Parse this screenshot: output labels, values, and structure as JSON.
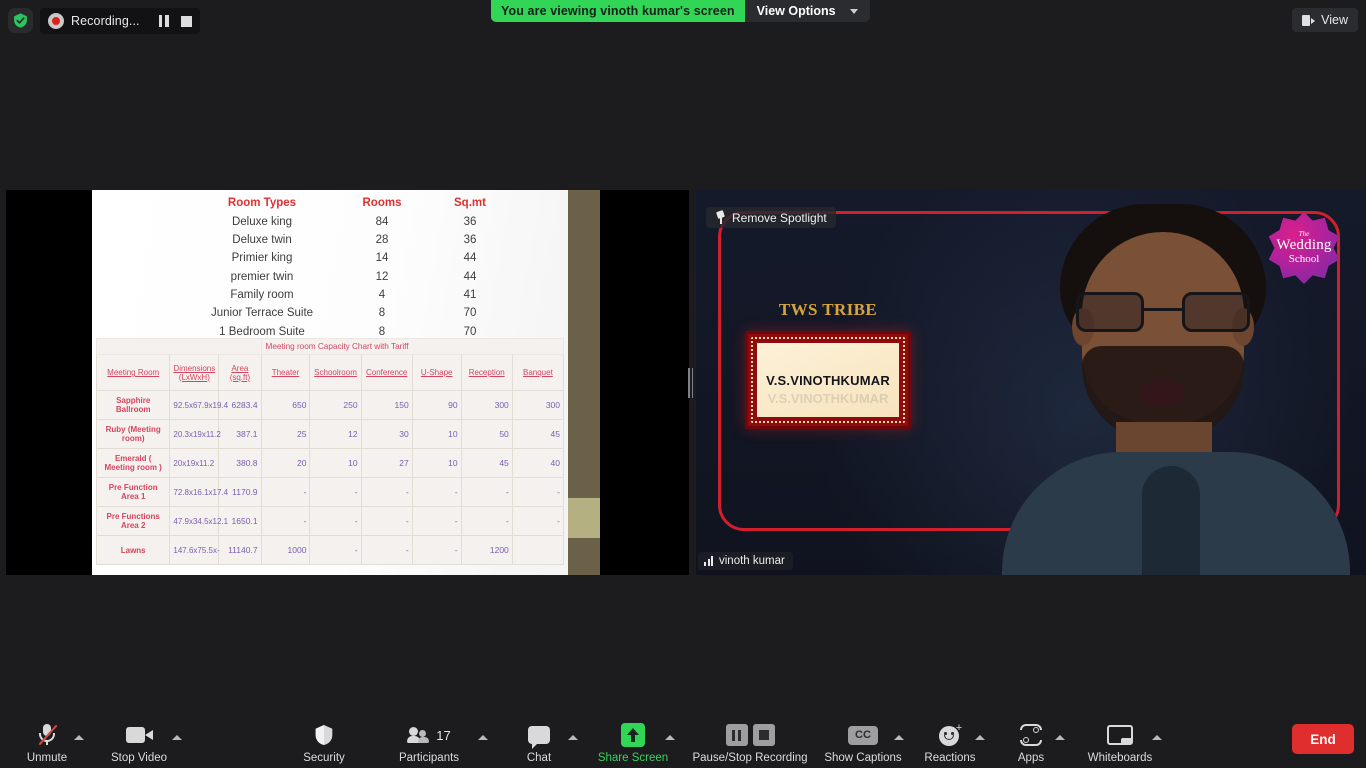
{
  "topbar": {
    "shield_icon": "shield-check-icon",
    "recording_label": "Recording...",
    "pause_icon": "pause-icon",
    "stop_icon": "stop-icon",
    "share_banner_text": "You are viewing vinoth kumar's screen",
    "view_options_label": "View Options",
    "view_options_caret": "chevron-down-icon",
    "view_button_label": "View",
    "view_button_icon": "layout-view-icon"
  },
  "shared_screen": {
    "room_table": {
      "headers": [
        "Room Types",
        "Rooms",
        "Sq.mt"
      ],
      "rows": [
        [
          "Deluxe king",
          "84",
          "36"
        ],
        [
          "Deluxe twin",
          "28",
          "36"
        ],
        [
          "Primier king",
          "14",
          "44"
        ],
        [
          "premier twin",
          "12",
          "44"
        ],
        [
          "Family room",
          "4",
          "41"
        ],
        [
          "Junior Terrace Suite",
          "8",
          "70"
        ],
        [
          "1 Bedroom Suite",
          "8",
          "70"
        ]
      ]
    },
    "capacity_table": {
      "title": "Meeting room Capacity Chart with Tariff",
      "headers": [
        "Meeting Room",
        "Dimensions (LxWxH)",
        "Area (sq.ft)",
        "Theater",
        "Schoolroom",
        "Conference",
        "U-Shape",
        "Reception",
        "Banquet"
      ],
      "rows": [
        [
          "Sapphire Ballroom",
          "92.5x67.9x19.4",
          "6283.4",
          "650",
          "250",
          "150",
          "90",
          "300",
          "300"
        ],
        [
          "Ruby (Meeting room)",
          "20.3x19x11.2",
          "387.1",
          "25",
          "12",
          "30",
          "10",
          "50",
          "45"
        ],
        [
          "Emerald ( Meeting room )",
          "20x19x11.2",
          "380.8",
          "20",
          "10",
          "27",
          "10",
          "45",
          "40"
        ],
        [
          "Pre Function Area 1",
          "72.8x16.1x17.4",
          "1170.9",
          "-",
          "-",
          "-",
          "-",
          "-",
          "-"
        ],
        [
          "Pre Functions Area 2",
          "47.9x34.5x12.1",
          "1650.1",
          "-",
          "-",
          "-",
          "-",
          "-",
          "-"
        ],
        [
          "Lawns",
          "147.6x75.5x-",
          "11140.7",
          "1000",
          "-",
          "-",
          "-",
          "1200",
          ""
        ]
      ]
    },
    "drag_handle_icon": "resize-handle-icon"
  },
  "video": {
    "spotlight_label": "Remove Spotlight",
    "spotlight_icon": "pin-icon",
    "participant_name": "vinoth kumar",
    "signal_icon": "signal-bars-icon",
    "slide_title": "TWS TRIBE",
    "name_card_text": "V.S.VINOTHKUMAR",
    "logo_line1": "The",
    "logo_line2": "Wedding",
    "logo_line3": "School",
    "frame_color": "#d11f2e"
  },
  "toolbar": {
    "items": [
      {
        "id": "unmute",
        "label": "Unmute",
        "icon": "microphone-muted-icon",
        "caret": true,
        "green": false
      },
      {
        "id": "stop-video",
        "label": "Stop Video",
        "icon": "camera-icon",
        "caret": true,
        "green": false
      },
      {
        "id": "security",
        "label": "Security",
        "icon": "shield-icon",
        "caret": false,
        "green": false
      },
      {
        "id": "participants",
        "label": "Participants",
        "icon": "people-icon",
        "caret": true,
        "green": false,
        "count": "17"
      },
      {
        "id": "chat",
        "label": "Chat",
        "icon": "chat-bubble-icon",
        "caret": true,
        "green": false
      },
      {
        "id": "share-screen",
        "label": "Share Screen",
        "icon": "share-screen-icon",
        "caret": true,
        "green": true
      },
      {
        "id": "recording",
        "label": "Pause/Stop Recording",
        "icon": "pause-stop-icon",
        "caret": false,
        "green": false
      },
      {
        "id": "captions",
        "label": "Show Captions",
        "icon": "cc-icon",
        "caret": true,
        "green": false
      },
      {
        "id": "reactions",
        "label": "Reactions",
        "icon": "emoji-plus-icon",
        "caret": true,
        "green": false
      },
      {
        "id": "apps",
        "label": "Apps",
        "icon": "apps-icon",
        "caret": true,
        "green": false
      },
      {
        "id": "whiteboards",
        "label": "Whiteboards",
        "icon": "whiteboard-icon",
        "caret": true,
        "green": false
      }
    ],
    "end_label": "End",
    "accent_green": "#32d657",
    "end_red": "#e02d2d"
  }
}
